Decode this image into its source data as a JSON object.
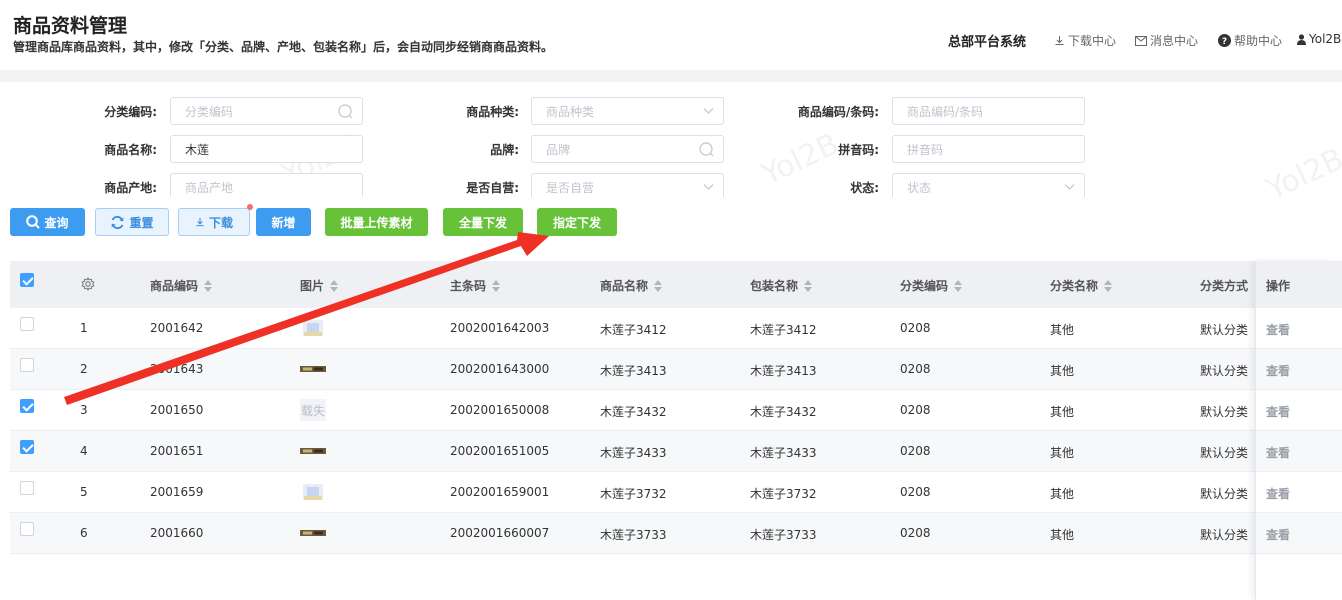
{
  "header": {
    "title": "商品资料管理",
    "description": "管理商品库商品资料，其中，修改「分类、品牌、产地、包装名称」后，会自动同步经销商商品资料。",
    "system_name": "总部平台系统",
    "links": {
      "download": "下载中心",
      "message": "消息中心",
      "help": "帮助中心",
      "user": "Yol2B"
    }
  },
  "filters": {
    "category_code": {
      "label": "分类编码:",
      "placeholder": "分类编码"
    },
    "product_type": {
      "label": "商品种类:",
      "placeholder": "商品种类"
    },
    "code_barcode": {
      "label": "商品编码/条码:",
      "placeholder": "商品编码/条码"
    },
    "product_name": {
      "label": "商品名称:",
      "value": "木莲"
    },
    "brand": {
      "label": "品牌:",
      "placeholder": "品牌"
    },
    "pinyin": {
      "label": "拼音码:",
      "placeholder": "拼音码"
    },
    "origin": {
      "label": "商品产地:",
      "placeholder": "商品产地"
    },
    "self_operated": {
      "label": "是否自营:",
      "placeholder": "是否自营"
    },
    "status": {
      "label": "状态:",
      "placeholder": "状态"
    }
  },
  "toolbar": {
    "query": "查询",
    "reset": "重置",
    "download": "下载",
    "add": "新增",
    "batch_upload": "批量上传素材",
    "push_all": "全量下发",
    "push_selected": "指定下发"
  },
  "table": {
    "columns": {
      "code": "商品编码",
      "image": "图片",
      "barcode": "主条码",
      "name": "商品名称",
      "pack_name": "包装名称",
      "category_code": "分类编码",
      "category_name": "分类名称",
      "category_mode": "分类方式",
      "action": "操作"
    },
    "header_checked": true,
    "rows": [
      {
        "idx": "1",
        "checked": false,
        "code": "2001642",
        "image": "thumb-photo",
        "barcode": "2002001642003",
        "name": "木莲子3412",
        "pack_name": "木莲子3412",
        "category_code": "0208",
        "category_name": "其他",
        "category_mode": "默认分类",
        "action": "查看"
      },
      {
        "idx": "2",
        "checked": false,
        "code": "2001643",
        "image": "thumb-label",
        "barcode": "2002001643000",
        "name": "木莲子3413",
        "pack_name": "木莲子3413",
        "category_code": "0208",
        "category_name": "其他",
        "category_mode": "默认分类",
        "action": "查看"
      },
      {
        "idx": "3",
        "checked": true,
        "code": "2001650",
        "image": "thumb-failed",
        "image_text": "载失",
        "barcode": "2002001650008",
        "name": "木莲子3432",
        "pack_name": "木莲子3432",
        "category_code": "0208",
        "category_name": "其他",
        "category_mode": "默认分类",
        "action": "查看"
      },
      {
        "idx": "4",
        "checked": true,
        "code": "2001651",
        "image": "thumb-label",
        "barcode": "2002001651005",
        "name": "木莲子3433",
        "pack_name": "木莲子3433",
        "category_code": "0208",
        "category_name": "其他",
        "category_mode": "默认分类",
        "action": "查看"
      },
      {
        "idx": "5",
        "checked": false,
        "code": "2001659",
        "image": "thumb-photo",
        "barcode": "2002001659001",
        "name": "木莲子3732",
        "pack_name": "木莲子3732",
        "category_code": "0208",
        "category_name": "其他",
        "category_mode": "默认分类",
        "action": "查看"
      },
      {
        "idx": "6",
        "checked": false,
        "code": "2001660",
        "image": "thumb-label",
        "barcode": "2002001660007",
        "name": "木莲子3733",
        "pack_name": "木莲子3733",
        "category_code": "0208",
        "category_name": "其他",
        "category_mode": "默认分类",
        "action": "查看"
      }
    ]
  },
  "watermark": "Yol2B",
  "colors": {
    "primary": "#3d9cf0",
    "success": "#67c23a",
    "annotation_arrow": "#ee3124"
  }
}
